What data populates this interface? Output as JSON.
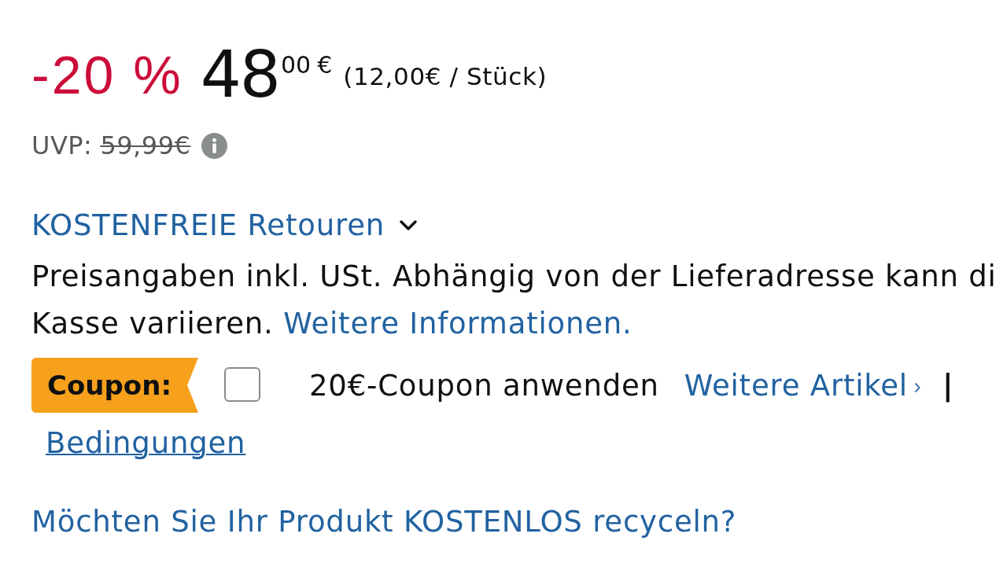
{
  "price": {
    "discount": "-20 %",
    "whole": "48",
    "fraction": "00",
    "currency": "€",
    "unit_price": "(12,00€ / Stück)"
  },
  "list_price": {
    "label": "UVP:",
    "value": "59,99€"
  },
  "returns_link": {
    "label": "KOSTENFREIE Retouren"
  },
  "notice": {
    "lines": [
      "Preisangaben inkl. USt. Abhängig von der Lieferadresse kann di",
      "Kasse variieren."
    ],
    "link": "Weitere Informationen."
  },
  "coupon": {
    "tag": "Coupon:",
    "checked": false,
    "label": "20€-Coupon anwenden",
    "more_link": "Weitere Artikel",
    "separator": "|",
    "terms_link": "Bedingungen"
  },
  "recycle_link": "Möchten Sie Ihr Produkt KOSTENLOS recyceln?"
}
